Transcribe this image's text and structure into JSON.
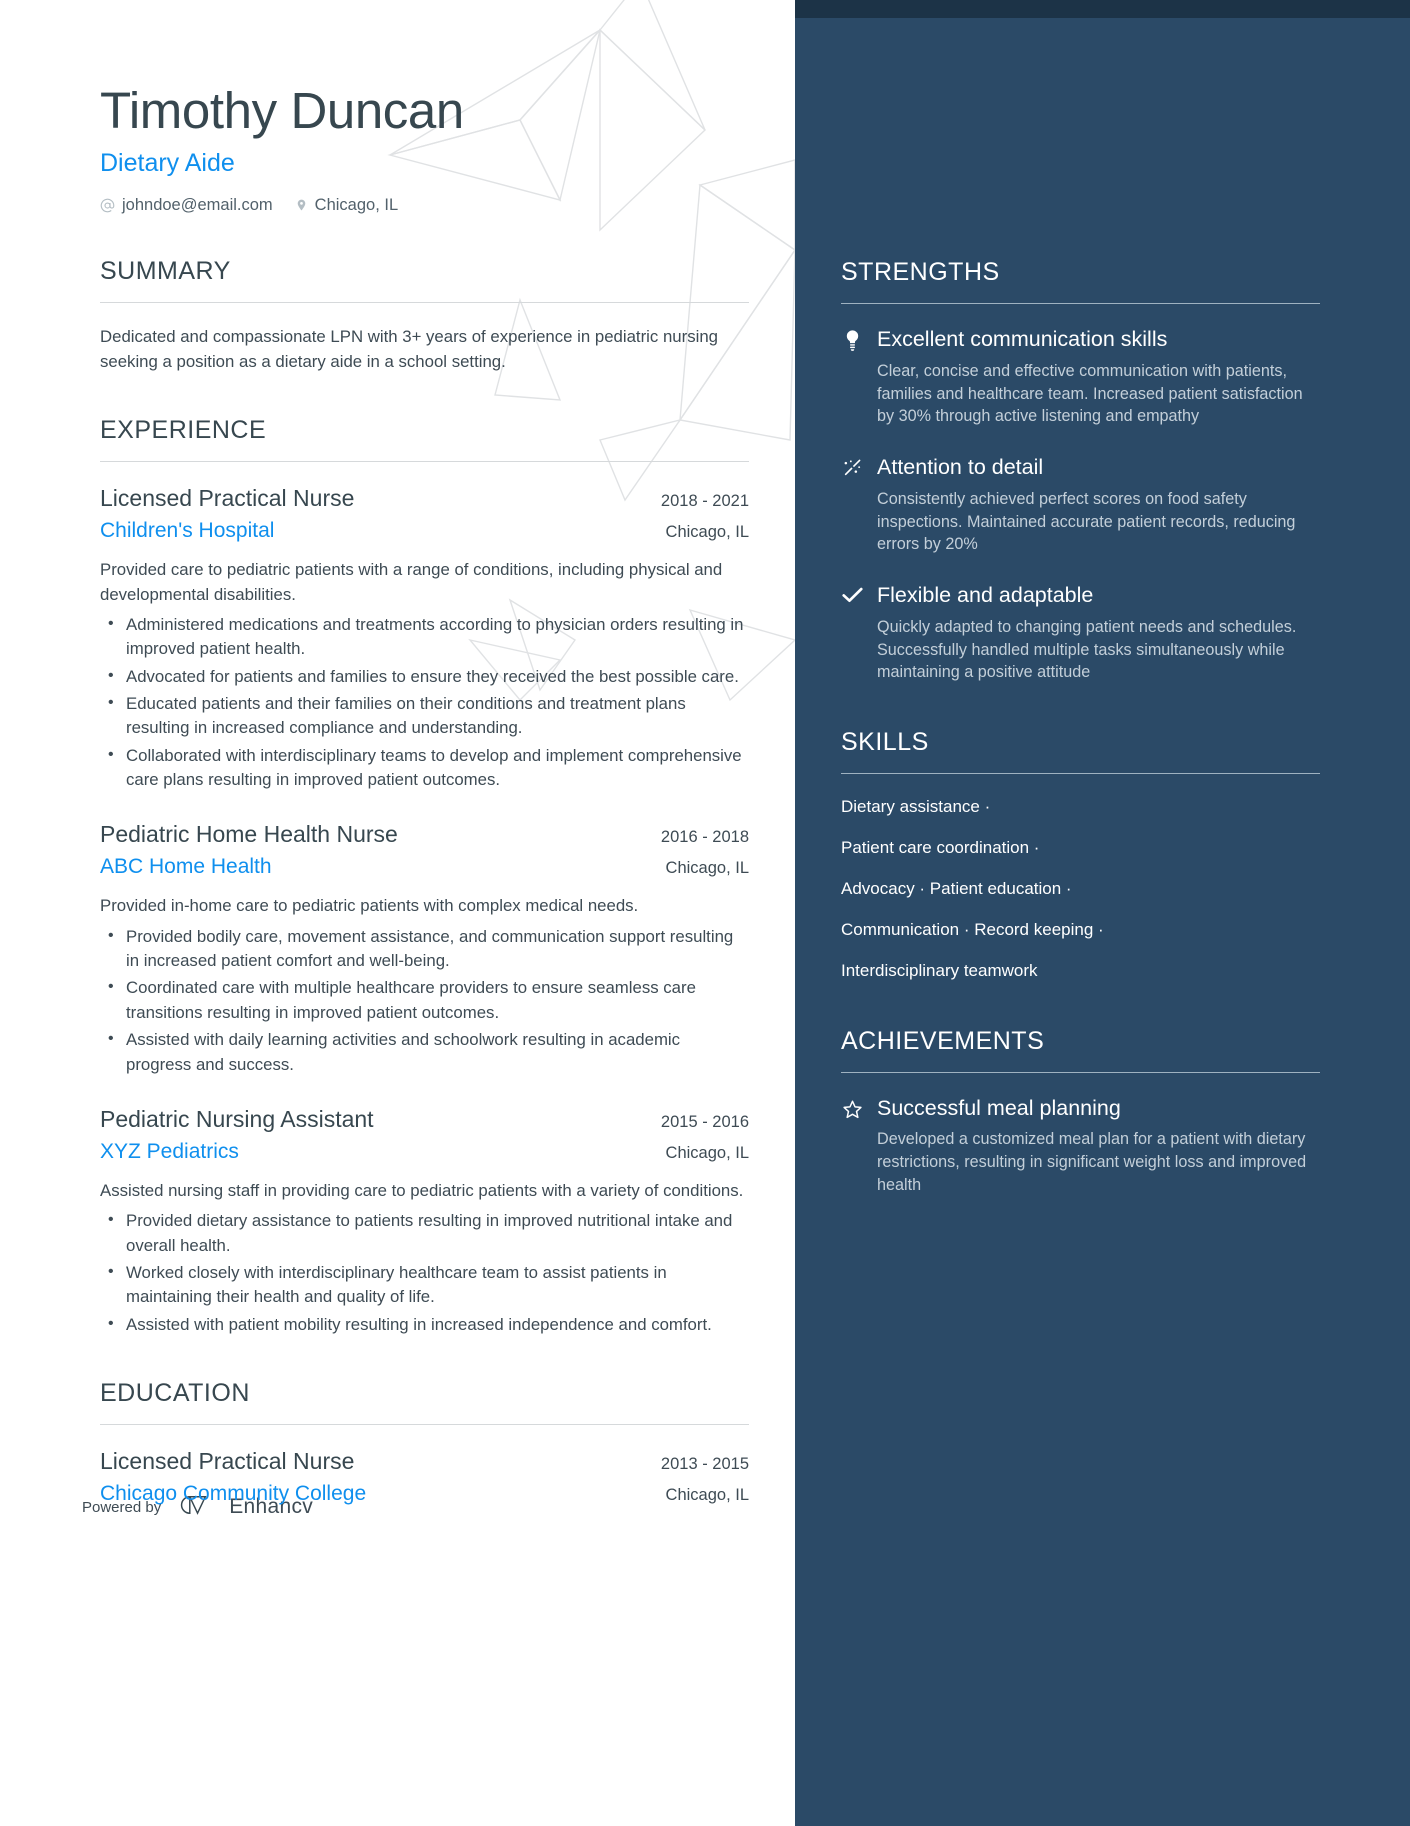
{
  "header": {
    "name": "Timothy Duncan",
    "job_title": "Dietary Aide",
    "email": "johndoe@email.com",
    "location": "Chicago, IL",
    "email_icon": "at-sign-icon",
    "location_icon": "map-pin-icon",
    "accent_color": "#0f8fee",
    "text_color": "#37474f"
  },
  "summary": {
    "heading": "SUMMARY",
    "text": "Dedicated and compassionate LPN with 3+ years of experience in pediatric nursing seeking a position as a dietary aide in a school setting."
  },
  "experience": {
    "heading": "EXPERIENCE",
    "entries": [
      {
        "title": "Licensed Practical Nurse",
        "date": "2018 - 2021",
        "org": "Children's Hospital",
        "location": "Chicago, IL",
        "description": "Provided care to pediatric patients with a range of conditions, including physical and developmental disabilities.",
        "bullets": [
          "Administered medications and treatments according to physician orders resulting in improved patient health.",
          "Advocated for patients and families to ensure they received the best possible care.",
          "Educated patients and their families on their conditions and treatment plans resulting in increased compliance and understanding.",
          "Collaborated with interdisciplinary teams to develop and implement comprehensive care plans resulting in improved patient outcomes."
        ]
      },
      {
        "title": "Pediatric Home Health Nurse",
        "date": "2016 - 2018",
        "org": "ABC Home Health",
        "location": "Chicago, IL",
        "description": "Provided in-home care to pediatric patients with complex medical needs.",
        "bullets": [
          "Provided bodily care, movement assistance, and communication support resulting in increased patient comfort and well-being.",
          "Coordinated care with multiple healthcare providers to ensure seamless care transitions resulting in improved patient outcomes.",
          "Assisted with daily learning activities and schoolwork resulting in academic progress and success."
        ]
      },
      {
        "title": "Pediatric Nursing Assistant",
        "date": "2015 - 2016",
        "org": "XYZ Pediatrics",
        "location": "Chicago, IL",
        "description": "Assisted nursing staff in providing care to pediatric patients with a variety of conditions.",
        "bullets": [
          "Provided dietary assistance to patients resulting in improved nutritional intake and overall health.",
          "Worked closely with interdisciplinary healthcare team to assist patients in maintaining their health and quality of life.",
          "Assisted with patient mobility resulting in increased independence and comfort."
        ]
      }
    ]
  },
  "education": {
    "heading": "EDUCATION",
    "entries": [
      {
        "title": "Licensed Practical Nurse",
        "date": "2013 - 2015",
        "org": "Chicago Community College",
        "location": "Chicago, IL"
      }
    ]
  },
  "footer": {
    "powered_by": "Powered by",
    "brand": "Enhancv",
    "brand_logo_icon": "enhancv-logo-icon",
    "url": "www.enhancv.com"
  },
  "sidebar": {
    "background_color": "#2b4a67",
    "topbar_color": "#1c3347",
    "strengths": {
      "heading": "STRENGTHS",
      "items": [
        {
          "icon": "lightbulb-icon",
          "title": "Excellent communication skills",
          "body": "Clear, concise and effective communication with patients, families and healthcare team. Increased patient satisfaction by 30% through active listening and empathy"
        },
        {
          "icon": "magic-wand-icon",
          "title": "Attention to detail",
          "body": "Consistently achieved perfect scores on food safety inspections. Maintained accurate patient records, reducing errors by 20%"
        },
        {
          "icon": "check-icon",
          "title": "Flexible and adaptable",
          "body": "Quickly adapted to changing patient needs and schedules. Successfully handled multiple tasks simultaneously while maintaining a positive attitude"
        }
      ]
    },
    "skills": {
      "heading": "SKILLS",
      "lines": [
        "Dietary assistance ·",
        "Patient care coordination ·",
        "Advocacy · Patient education ·",
        "Communication · Record keeping ·",
        "Interdisciplinary teamwork"
      ]
    },
    "achievements": {
      "heading": "ACHIEVEMENTS",
      "items": [
        {
          "icon": "star-icon",
          "title": "Successful meal planning",
          "body": "Developed a customized meal plan for a patient with dietary restrictions, resulting in significant weight loss and improved health"
        }
      ]
    }
  }
}
